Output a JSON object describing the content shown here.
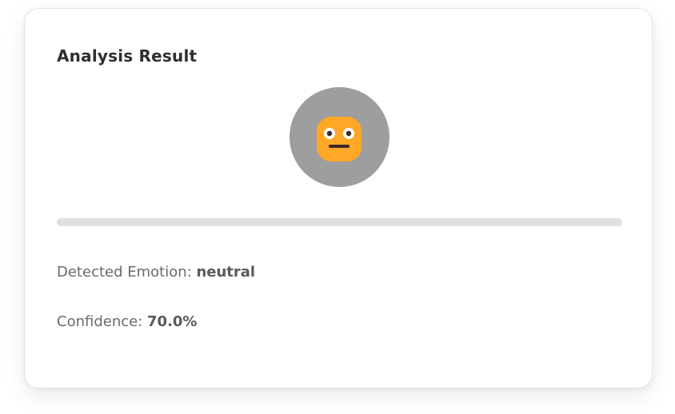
{
  "card": {
    "title": "Analysis Result"
  },
  "emotion_icon": {
    "name": "neutral-face-icon",
    "circle_color": "#9e9e9e",
    "face_color": "#ffa726"
  },
  "progress": {
    "value_fraction": 0,
    "track_color": "#e0e0e0"
  },
  "result": {
    "emotion_label": "Detected Emotion:",
    "emotion_value": "neutral",
    "confidence_label": "Confidence:",
    "confidence_value": "70.0%"
  }
}
